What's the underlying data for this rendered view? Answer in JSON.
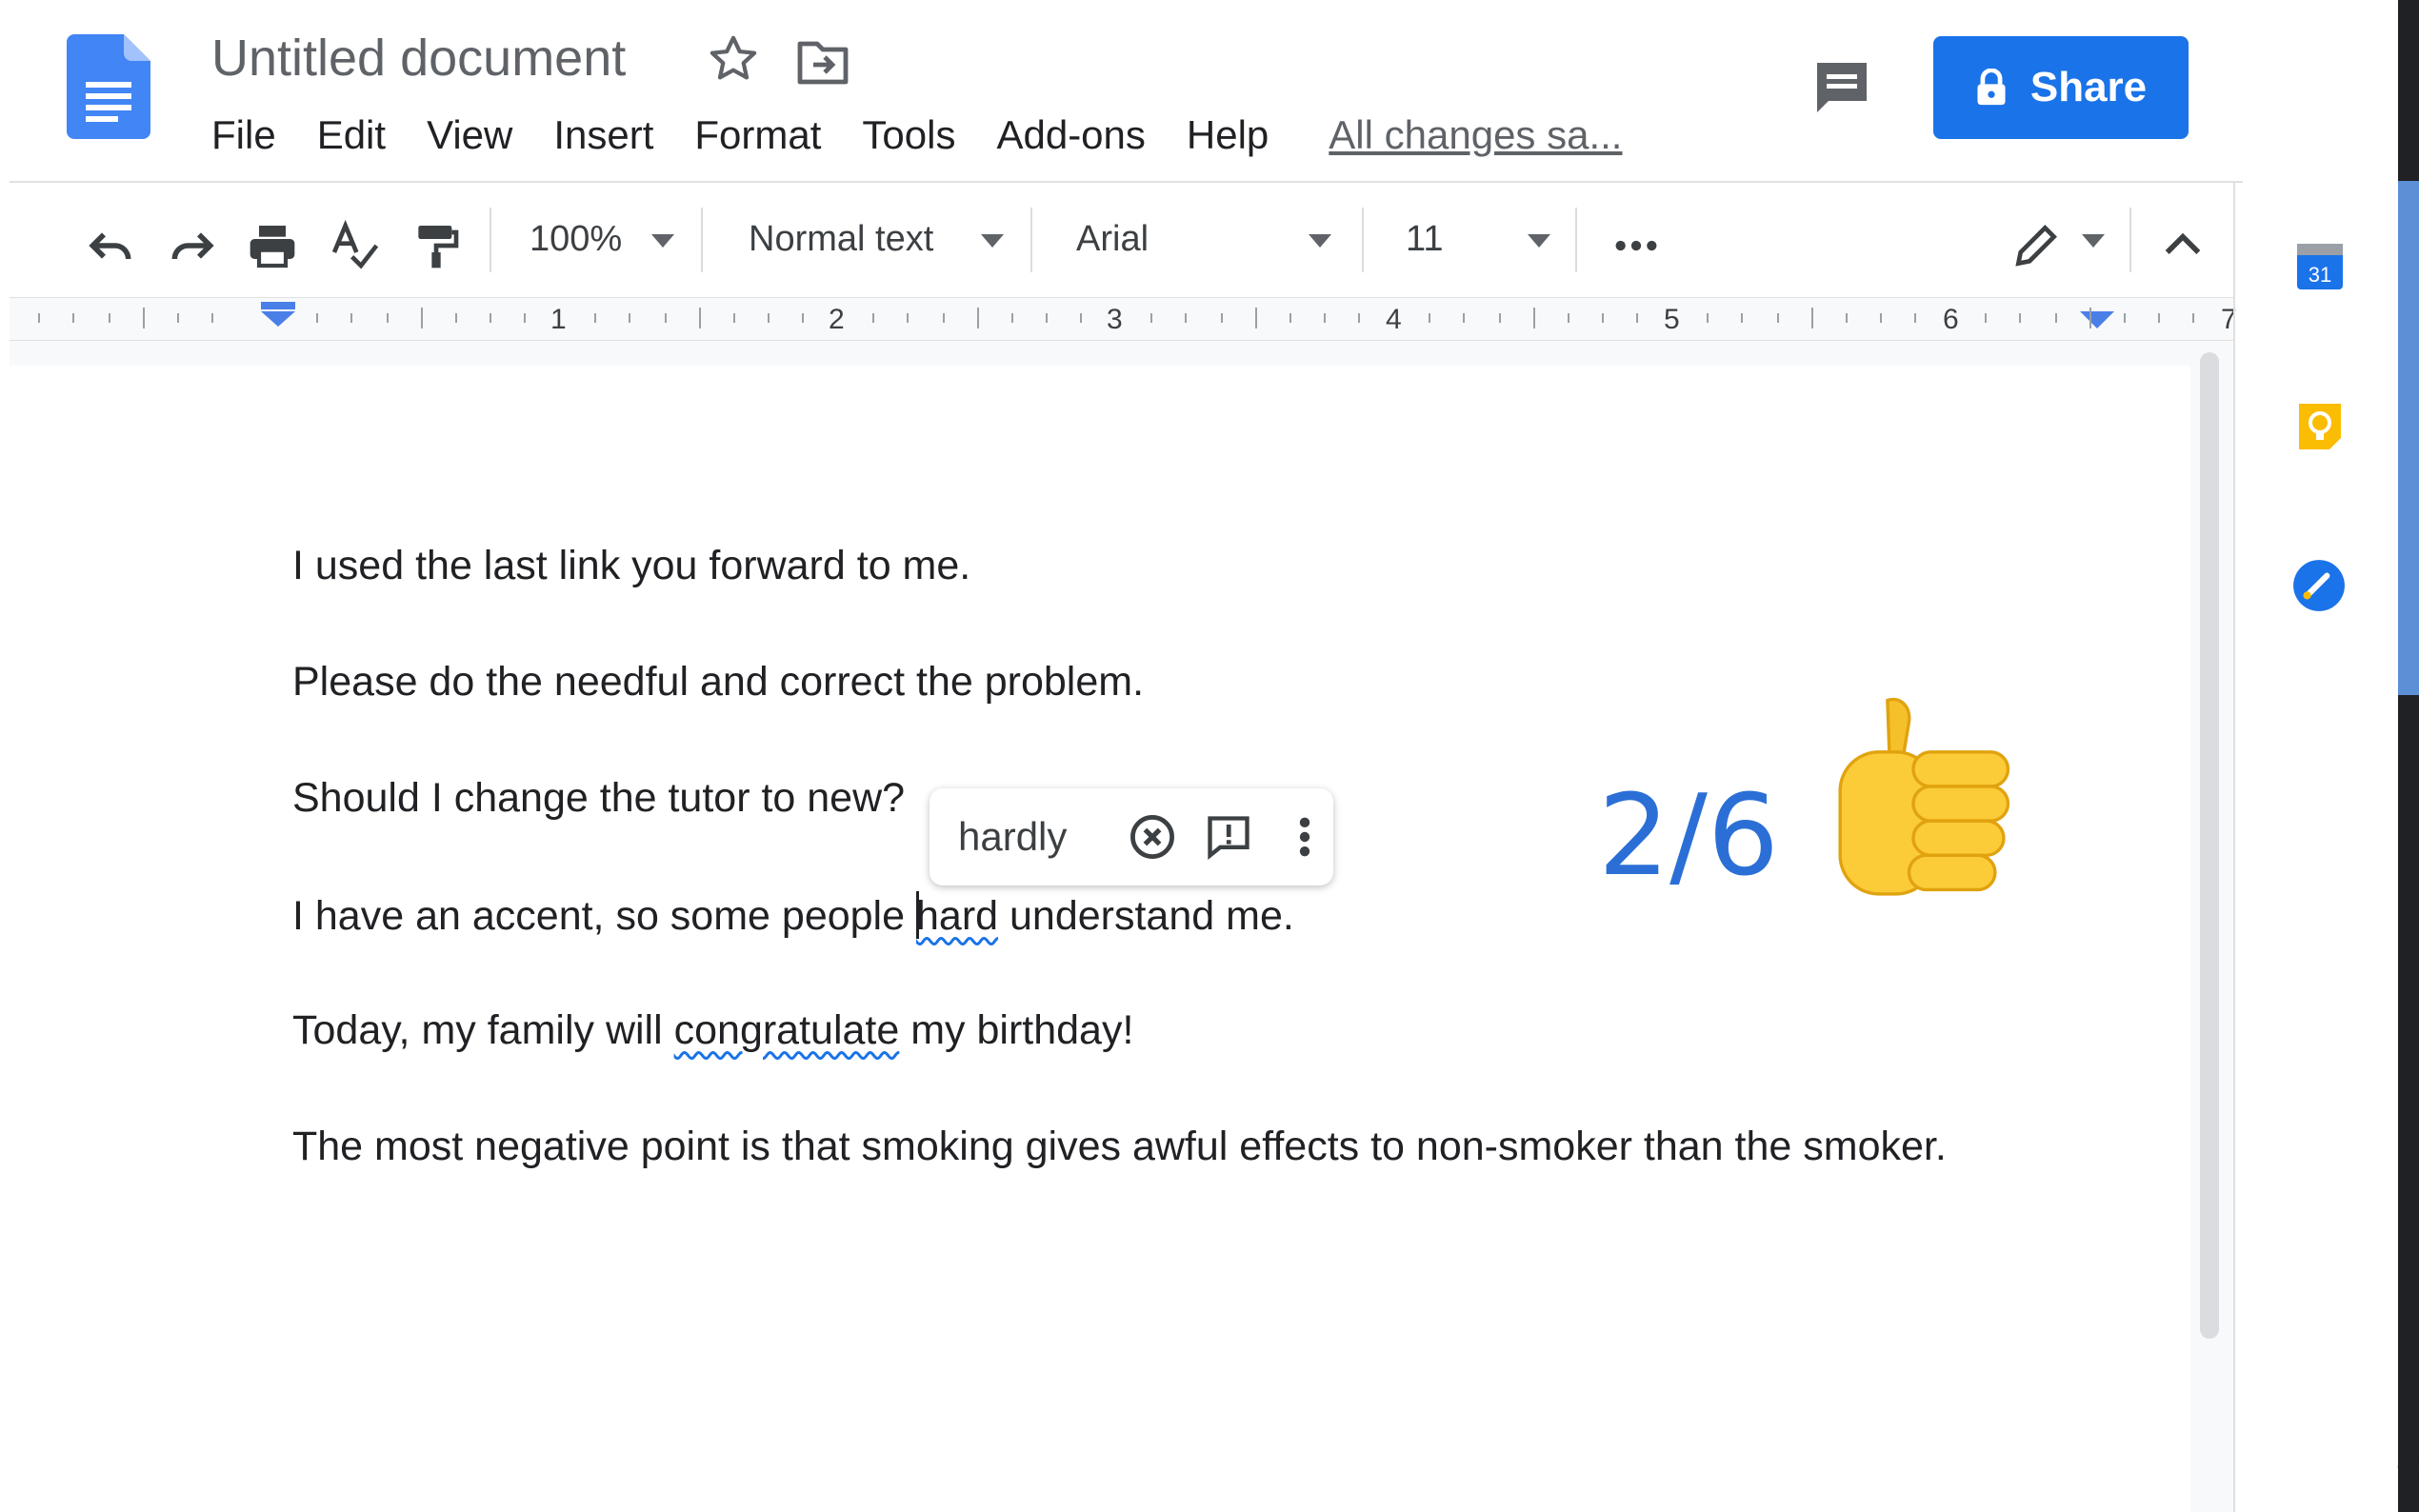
{
  "header": {
    "title": "Untitled document",
    "menus": [
      "File",
      "Edit",
      "View",
      "Insert",
      "Format",
      "Tools",
      "Add-ons",
      "Help"
    ],
    "save_status": "All changes sa...",
    "share_label": "Share"
  },
  "toolbar": {
    "zoom": "100%",
    "style": "Normal text",
    "font": "Arial",
    "font_size": "11",
    "icons": [
      "undo-icon",
      "redo-icon",
      "print-icon",
      "spellcheck-icon",
      "paint-format-icon",
      "more-icon",
      "editing-mode-icon",
      "collapse-icon"
    ]
  },
  "ruler": {
    "numbers": [
      "1",
      "2",
      "3",
      "4",
      "5",
      "6",
      "7"
    ]
  },
  "document": {
    "line1": "I used the last link you forward to me.",
    "line2": "Please do the needful and correct the problem.",
    "line3": "Should I change the tutor to new?",
    "line4_before": "I have an accent, so some people ",
    "line4_flagged": "hard",
    "line4_after": " understand me.",
    "line5_before": "Today, my family will ",
    "line5_flagged": "congratulate",
    "line5_after": " my birthday!",
    "line6": "The most negative point is that smoking gives awful effects to non-smoker than the smoker."
  },
  "suggestion": {
    "word": "hardly"
  },
  "overlay": {
    "score": "2/6",
    "emoji": "thumbs-up-icon"
  },
  "edge_char": "C",
  "colors": {
    "accent": "#1a73e8",
    "score": "#2b6fd6",
    "doc_icon": "#4285f4",
    "keep": "#fbbc04"
  }
}
